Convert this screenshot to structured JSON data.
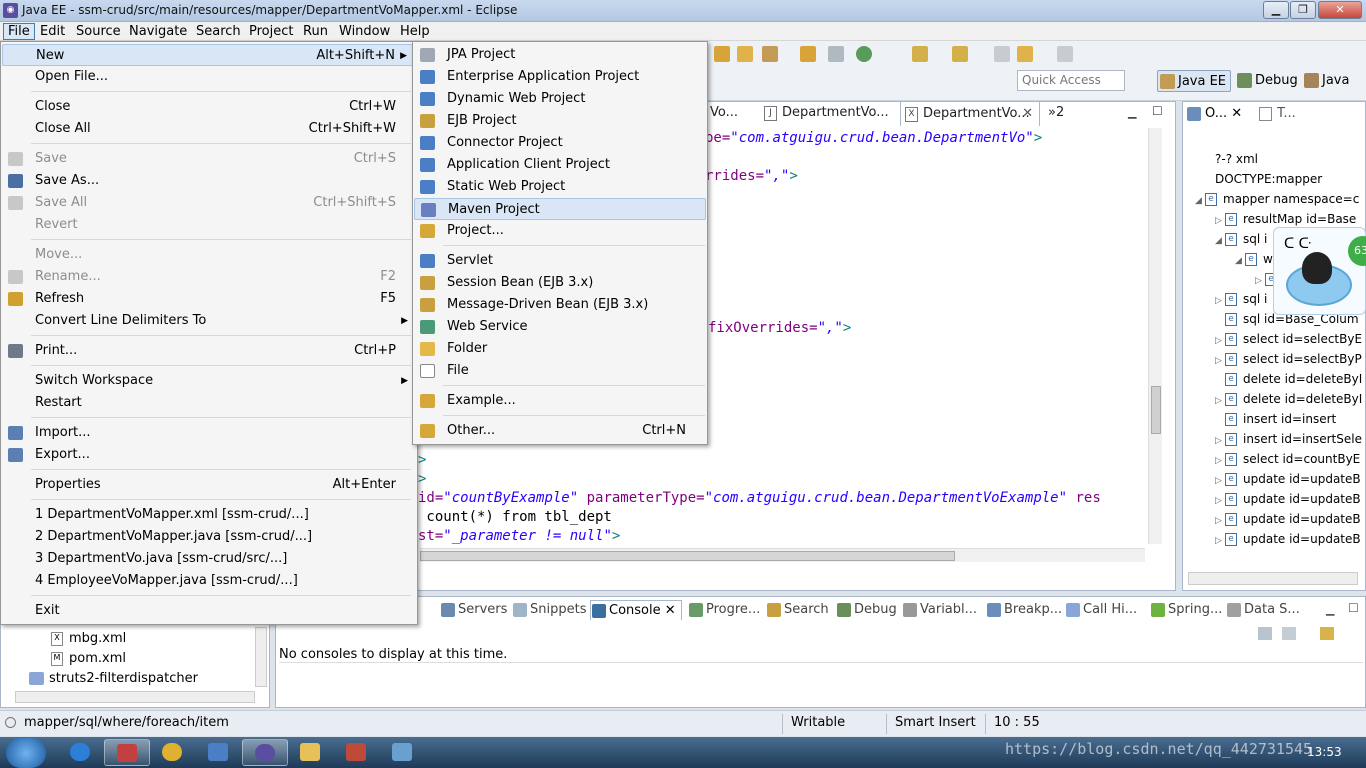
{
  "window": {
    "title": "Java EE - ssm-crud/src/main/resources/mapper/DepartmentVoMapper.xml - Eclipse"
  },
  "menubar": [
    "File",
    "Edit",
    "Source",
    "Navigate",
    "Search",
    "Project",
    "Run",
    "Window",
    "Help"
  ],
  "quick_access": "Quick Access",
  "perspectives": [
    "Java EE",
    "Debug",
    "Java"
  ],
  "editor_tabs": [
    "Vo...",
    "DepartmentVo...",
    "DepartmentVo...",
    "»2"
  ],
  "code_lines": [
    {
      "pre": "pe=",
      "str": "\"com.atguigu.crud.bean.DepartmentVo\"",
      "post": ">"
    },
    {
      "pre": "rrides=",
      "str": "\",\"",
      "post": ">"
    },
    {
      "pre": "fixOverrides=",
      "str": "\",\"",
      "post": ">"
    },
    {
      "pre": ">",
      "str": "",
      "post": ""
    },
    {
      "pre": ">",
      "str": "",
      "post": ""
    },
    {
      "pre": "id=",
      "str": "\"countByExample\"",
      "post": " parameterType=",
      "str2": "\"com.atguigu.crud.bean.DepartmentVoExample\"",
      "post2": " res"
    },
    {
      "pre": " count(*) from tbl_dept",
      "str": "",
      "post": ""
    },
    {
      "pre": "st=",
      "str": "\"_parameter != null\"",
      "post": ">"
    }
  ],
  "outline": {
    "tabs": [
      "O...",
      "T..."
    ],
    "items": [
      {
        "text": "?-? xml",
        "tw": ""
      },
      {
        "text": "DOCTYPE:mapper",
        "tw": ""
      },
      {
        "text": "mapper namespace=c",
        "tw": "◢"
      },
      {
        "text": "resultMap id=Base",
        "tw": "▷"
      },
      {
        "text": "sql i",
        "tw": "◢"
      },
      {
        "text": "w",
        "tw": "◢"
      },
      {
        "text": "",
        "tw": "▷"
      },
      {
        "text": "sql i",
        "tw": "▷"
      },
      {
        "text": "sql id=Base_Colum",
        "tw": ""
      },
      {
        "text": "select id=selectByE",
        "tw": "▷"
      },
      {
        "text": "select id=selectByP",
        "tw": "▷"
      },
      {
        "text": "delete id=deleteByI",
        "tw": ""
      },
      {
        "text": "delete id=deleteByI",
        "tw": "▷"
      },
      {
        "text": "insert id=insert",
        "tw": ""
      },
      {
        "text": "insert id=insertSele",
        "tw": "▷"
      },
      {
        "text": "select id=countByE",
        "tw": "▷"
      },
      {
        "text": "update id=updateB",
        "tw": "▷"
      },
      {
        "text": "update id=updateB",
        "tw": "▷"
      },
      {
        "text": "update id=updateB",
        "tw": "▷"
      },
      {
        "text": "update id=updateB",
        "tw": "▷"
      }
    ]
  },
  "float_badge": "63",
  "bottom_tabs": [
    "Servers",
    "Snippets",
    "Console",
    "Progre...",
    "Search",
    "Debug",
    "Variabl...",
    "Breakp...",
    "Call Hi...",
    "Spring...",
    "Data S..."
  ],
  "console_message": "No consoles to display at this time.",
  "explorer": {
    "items": [
      "mbg.xml",
      "pom.xml",
      "struts2-filterdispatcher"
    ]
  },
  "status": {
    "path": "mapper/sql/where/foreach/item",
    "writable": "Writable",
    "insert_mode": "Smart Insert",
    "position": "10 : 55"
  },
  "taskbar": {
    "clock": "13:53",
    "watermark": "https://blog.csdn.net/qq_442731545"
  },
  "file_menu": [
    {
      "label": "New",
      "acc": "Alt+Shift+N",
      "sub": true,
      "hi": true,
      "dis": false
    },
    {
      "label": "Open File...",
      "acc": "",
      "dis": false
    },
    {
      "sep": true
    },
    {
      "label": "Close",
      "acc": "Ctrl+W",
      "dis": false
    },
    {
      "label": "Close All",
      "acc": "Ctrl+Shift+W",
      "dis": false
    },
    {
      "sep": true
    },
    {
      "label": "Save",
      "acc": "Ctrl+S",
      "dis": true
    },
    {
      "label": "Save As...",
      "acc": "",
      "dis": false
    },
    {
      "label": "Save All",
      "acc": "Ctrl+Shift+S",
      "dis": true
    },
    {
      "label": "Revert",
      "acc": "",
      "dis": true
    },
    {
      "sep": true
    },
    {
      "label": "Move...",
      "acc": "",
      "dis": true
    },
    {
      "label": "Rename...",
      "acc": "F2",
      "dis": true
    },
    {
      "label": "Refresh",
      "acc": "F5",
      "dis": false
    },
    {
      "label": "Convert Line Delimiters To",
      "acc": "",
      "sub": true,
      "dis": false
    },
    {
      "sep": true
    },
    {
      "label": "Print...",
      "acc": "Ctrl+P",
      "dis": false
    },
    {
      "sep": true
    },
    {
      "label": "Switch Workspace",
      "acc": "",
      "sub": true,
      "dis": false
    },
    {
      "label": "Restart",
      "acc": "",
      "dis": false
    },
    {
      "sep": true
    },
    {
      "label": "Import...",
      "acc": "",
      "dis": false
    },
    {
      "label": "Export...",
      "acc": "",
      "dis": false
    },
    {
      "sep": true
    },
    {
      "label": "Properties",
      "acc": "Alt+Enter",
      "dis": false
    },
    {
      "sep": true
    },
    {
      "label": "1 DepartmentVoMapper.xml  [ssm-crud/...]",
      "acc": "",
      "dis": false
    },
    {
      "label": "2 DepartmentVoMapper.java  [ssm-crud/...]",
      "acc": "",
      "dis": false
    },
    {
      "label": "3 DepartmentVo.java  [ssm-crud/src/...]",
      "acc": "",
      "dis": false
    },
    {
      "label": "4 EmployeeVoMapper.java  [ssm-crud/...]",
      "acc": "",
      "dis": false
    },
    {
      "sep": true
    },
    {
      "label": "Exit",
      "acc": "",
      "dis": false
    }
  ],
  "new_menu": [
    {
      "label": "JPA Project",
      "acc": ""
    },
    {
      "label": "Enterprise Application Project",
      "acc": ""
    },
    {
      "label": "Dynamic Web Project",
      "acc": ""
    },
    {
      "label": "EJB Project",
      "acc": ""
    },
    {
      "label": "Connector Project",
      "acc": ""
    },
    {
      "label": "Application Client Project",
      "acc": ""
    },
    {
      "label": "Static Web Project",
      "acc": ""
    },
    {
      "label": "Maven Project",
      "acc": "",
      "hi": true
    },
    {
      "label": "Project...",
      "acc": ""
    },
    {
      "sep": true
    },
    {
      "label": "Servlet",
      "acc": ""
    },
    {
      "label": "Session Bean (EJB 3.x)",
      "acc": ""
    },
    {
      "label": "Message-Driven Bean (EJB 3.x)",
      "acc": ""
    },
    {
      "label": "Web Service",
      "acc": ""
    },
    {
      "label": "Folder",
      "acc": ""
    },
    {
      "label": "File",
      "acc": ""
    },
    {
      "sep": true
    },
    {
      "label": "Example...",
      "acc": ""
    },
    {
      "sep": true
    },
    {
      "label": "Other...",
      "acc": "Ctrl+N"
    }
  ],
  "colors": {
    "accent": "#3c7fb1",
    "string": "#2a00ff",
    "menu_hi": "#d8e6f5"
  }
}
